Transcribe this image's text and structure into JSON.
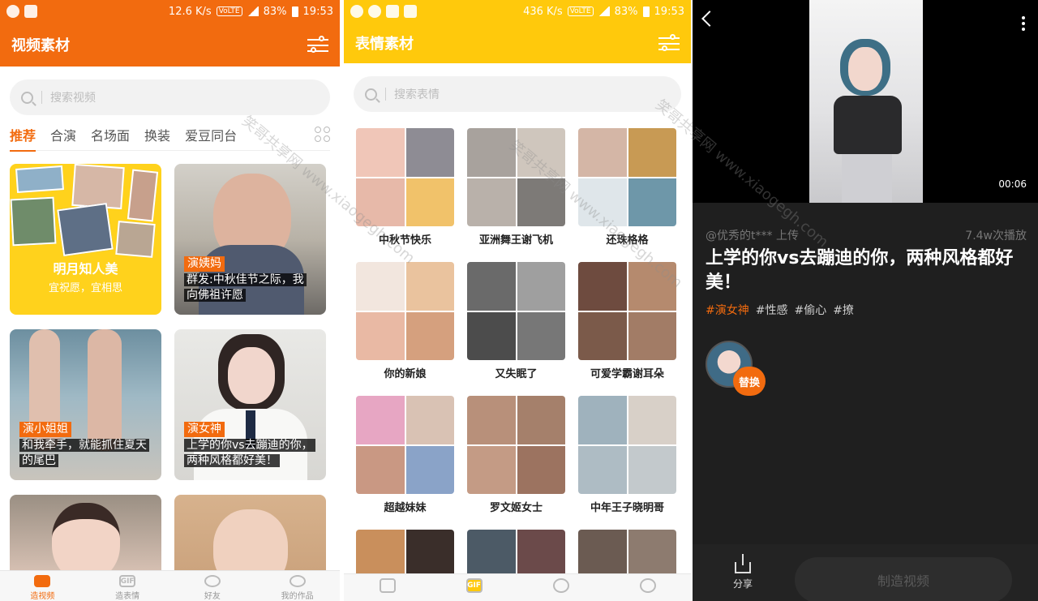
{
  "screen1": {
    "status": {
      "speed": "12.6 K/s",
      "network": "VoLTE",
      "battery": "83%",
      "time": "19:53"
    },
    "title": "视频素材",
    "search_placeholder": "搜索视频",
    "tabs": [
      "推荐",
      "合演",
      "名场面",
      "换装",
      "爱豆同台"
    ],
    "active_tab": "推荐",
    "cards": [
      {
        "kind": "feature",
        "title": "明月知人美",
        "subtitle": "宜祝愿，宜相思"
      },
      {
        "kind": "video",
        "tag": "演姨妈",
        "lines": [
          "群发:中秋佳节之际，我",
          "向佛祖许愿"
        ]
      },
      {
        "kind": "video",
        "tag": "演小姐姐",
        "lines": [
          "和我牵手，就能抓住夏天",
          "的尾巴"
        ]
      },
      {
        "kind": "video",
        "tag": "演女神",
        "lines": [
          "上学的你vs去蹦迪的你，",
          "两种风格都好美！"
        ]
      }
    ],
    "nav": [
      "造视频",
      "造表情",
      "好友",
      "我的作品"
    ],
    "accent": "#f26b0f"
  },
  "screen2": {
    "status": {
      "speed": "436 K/s",
      "network": "VoLTE",
      "battery": "83%",
      "time": "19:53"
    },
    "title": "表情素材",
    "search_placeholder": "搜索表情",
    "packs": [
      "中秋节快乐",
      "亚洲舞王谢飞机",
      "还珠格格",
      "你的新娘",
      "又失眠了",
      "可爱学霸谢耳朵",
      "超越妹妹",
      "罗文姬女士",
      "中年王子晓明哥"
    ],
    "nav_gif": "GIF",
    "accent": "#ffc90c"
  },
  "screen3": {
    "duration": "00:06",
    "uploader": "@优秀的t*** 上传",
    "plays": "7.4w次播放",
    "title": "上学的你vs去蹦迪的你，两种风格都好美！",
    "hashtags": [
      "#演女神",
      "#性感",
      "#偷心",
      "#撩"
    ],
    "swap_label": "替换",
    "share_label": "分享",
    "make_label": "制造视频"
  },
  "watermark": "笑哥共享网 www.xiaogegh.com"
}
